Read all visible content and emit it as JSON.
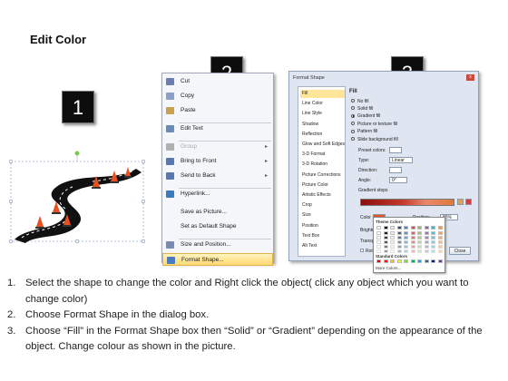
{
  "title": "Edit Color",
  "steps": [
    "1",
    "2",
    "3"
  ],
  "context_menu": {
    "items": [
      {
        "label": "Cut",
        "key": "t",
        "icon": "scissors-icon",
        "color": "#6a7fb0"
      },
      {
        "label": "Copy",
        "icon": "copy-icon",
        "color": "#8aa0c8"
      },
      {
        "label": "Paste",
        "icon": "paste-icon",
        "color": "#c8a050"
      },
      {
        "label": "Edit Text",
        "icon": "edit-text-icon",
        "color": "#6a8ab8"
      },
      {
        "label": "Group",
        "icon": "group-icon",
        "color": "#b0b0b0",
        "disabled": true,
        "submenu": true
      },
      {
        "label": "Bring to Front",
        "icon": "bring-to-front-icon",
        "color": "#5a78b0",
        "submenu": true
      },
      {
        "label": "Send to Back",
        "icon": "send-to-back-icon",
        "color": "#5a78b0",
        "submenu": true
      },
      {
        "label": "Hyperlink...",
        "icon": "hyperlink-icon",
        "color": "#3a7ac0"
      },
      {
        "label": "Save as Picture...",
        "icon": "none"
      },
      {
        "label": "Set as Default Shape",
        "icon": "none"
      },
      {
        "label": "Size and Position...",
        "icon": "size-position-icon",
        "color": "#7a8ab0"
      },
      {
        "label": "Format Shape...",
        "icon": "format-shape-icon",
        "color": "#4a7ac0",
        "highlighted": true
      }
    ]
  },
  "dialog": {
    "title": "Format Shape",
    "close": "x",
    "categories": [
      "Fill",
      "Line Color",
      "Line Style",
      "Shadow",
      "Reflection",
      "Glow and Soft Edges",
      "3-D Format",
      "3-D Rotation",
      "Picture Corrections",
      "Picture Color",
      "Artistic Effects",
      "Crop",
      "Size",
      "Position",
      "Text Box",
      "Alt Text"
    ],
    "selected_category": "Fill",
    "fill_heading": "Fill",
    "fill_options": [
      "No fill",
      "Solid fill",
      "Gradient fill",
      "Picture or texture fill",
      "Pattern fill",
      "Slide background fill"
    ],
    "selected_fill": "Gradient fill",
    "preset_colors_label": "Preset colors:",
    "type_label": "Type:",
    "type_value": "Linear",
    "direction_label": "Direction:",
    "angle_label": "Angle:",
    "angle_value": "0°",
    "gradient_stops_label": "Gradient stops",
    "color_label": "Color",
    "position_label": "Position:",
    "position_value": "85%",
    "brightness_label": "Brightness",
    "transparency_label": "Transparency",
    "rotate_label": "Rotate with shape",
    "theme_colors_label": "Theme Colors",
    "standard_colors_label": "Standard Colors",
    "more_colors_label": "More Colors...",
    "close_button": "Close",
    "theme_colors": [
      "#ffffff",
      "#000000",
      "#eeece1",
      "#1f497d",
      "#4f81bd",
      "#c0504d",
      "#9bbb59",
      "#8064a2",
      "#4bacc6",
      "#f79646"
    ],
    "standard_colors": [
      "#c00000",
      "#ff0000",
      "#ffc000",
      "#ffff00",
      "#92d050",
      "#00b050",
      "#00b0f0",
      "#0070c0",
      "#002060",
      "#7030a0"
    ]
  },
  "instructions": [
    {
      "num": "1.",
      "text": "Select the shape to change the color and Right click the object( click any object which you want to change color)"
    },
    {
      "num": "2.",
      "text": "Choose Format Shape in the dialog box."
    },
    {
      "num": "3.",
      "text": "Choose “Fill” in the Format Shape box then “Solid” or “Gradient” depending on the appearance of the object. Change colour as shown in the picture."
    }
  ]
}
